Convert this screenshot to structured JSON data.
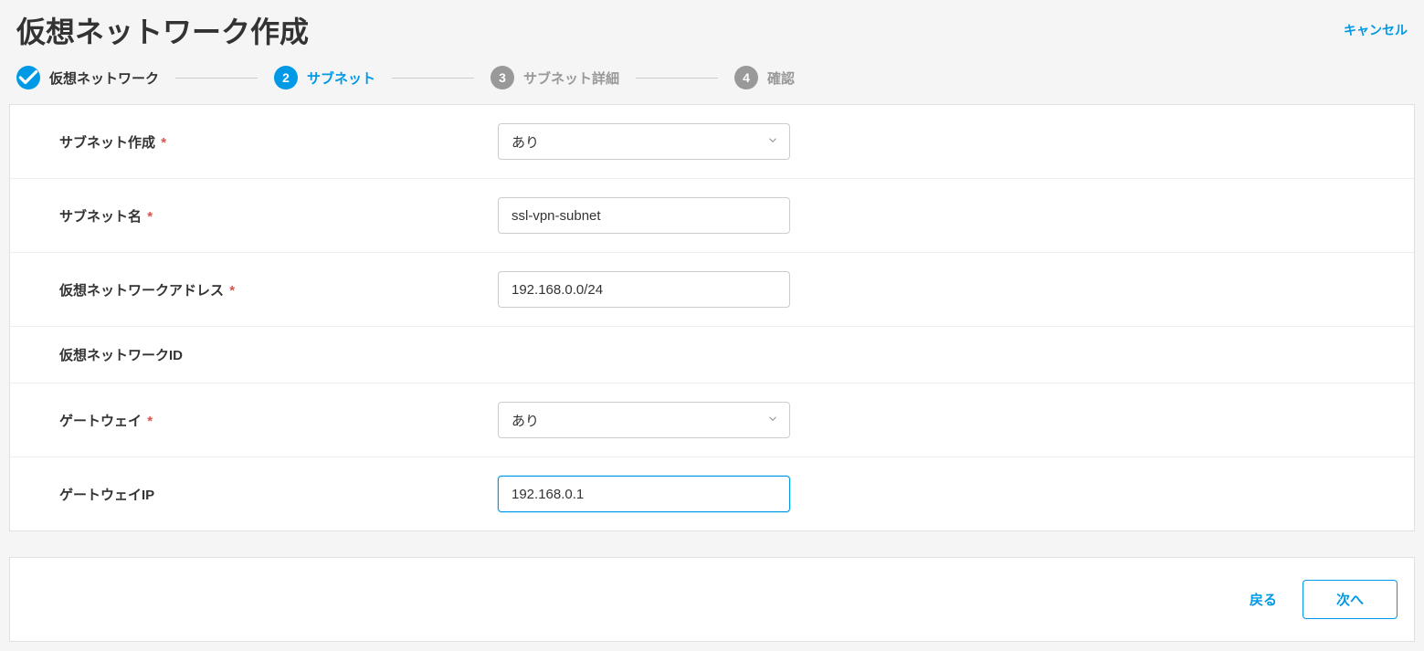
{
  "header": {
    "title": "仮想ネットワーク作成",
    "cancel": "キャンセル"
  },
  "stepper": {
    "step1": {
      "label": "仮想ネットワーク"
    },
    "step2": {
      "number": "2",
      "label": "サブネット"
    },
    "step3": {
      "number": "3",
      "label": "サブネット詳細"
    },
    "step4": {
      "number": "4",
      "label": "確認"
    }
  },
  "form": {
    "subnet_create": {
      "label": "サブネット作成",
      "value": "あり",
      "required": true
    },
    "subnet_name": {
      "label": "サブネット名",
      "value": "ssl-vpn-subnet",
      "required": true
    },
    "vnet_address": {
      "label": "仮想ネットワークアドレス",
      "value": "192.168.0.0/24",
      "required": true
    },
    "vnet_id": {
      "label": "仮想ネットワークID",
      "required": false
    },
    "gateway": {
      "label": "ゲートウェイ",
      "value": "あり",
      "required": true
    },
    "gateway_ip": {
      "label": "ゲートウェイIP",
      "value": "192.168.0.1",
      "required": false
    }
  },
  "footer": {
    "back": "戻る",
    "next": "次へ"
  },
  "required_mark": "*"
}
